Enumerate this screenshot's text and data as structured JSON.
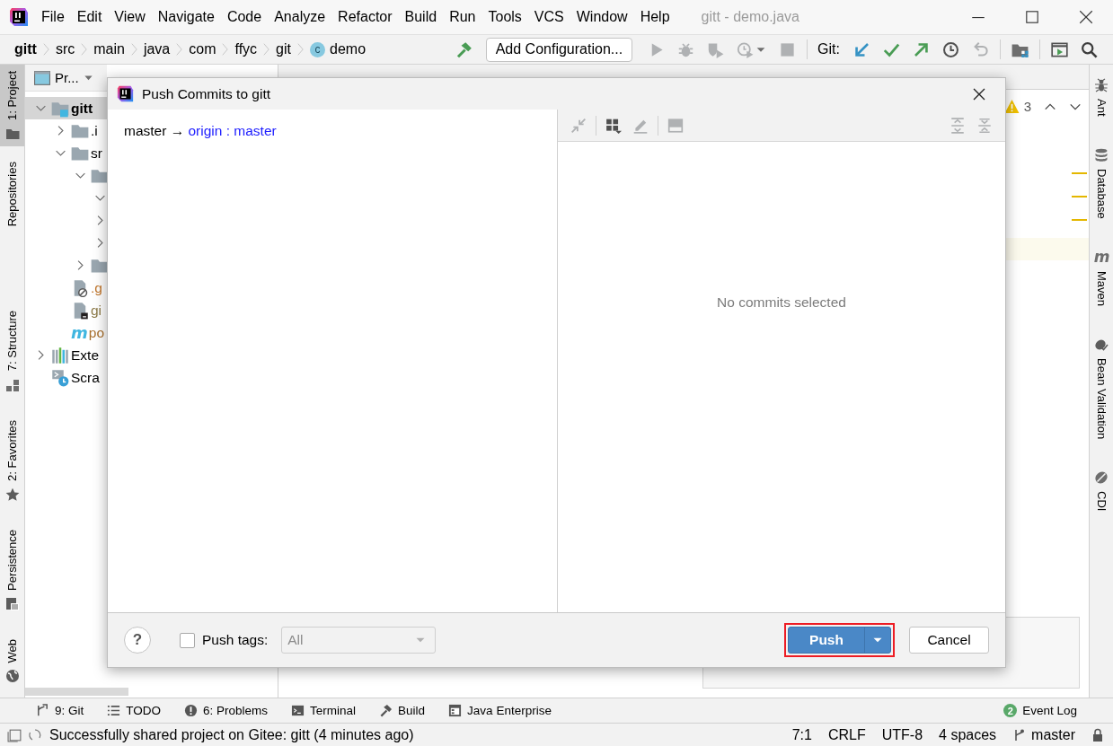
{
  "window": {
    "title": "gitt - demo.java"
  },
  "menu": [
    "File",
    "Edit",
    "View",
    "Navigate",
    "Code",
    "Analyze",
    "Refactor",
    "Build",
    "Run",
    "Tools",
    "VCS",
    "Window",
    "Help"
  ],
  "breadcrumbs": [
    {
      "label": "gitt",
      "kind": "project"
    },
    {
      "label": "src",
      "kind": "folder"
    },
    {
      "label": "main",
      "kind": "folder"
    },
    {
      "label": "java",
      "kind": "folder"
    },
    {
      "label": "com",
      "kind": "folder"
    },
    {
      "label": "ffyc",
      "kind": "folder"
    },
    {
      "label": "git",
      "kind": "folder"
    },
    {
      "label": "demo",
      "kind": "class",
      "icon_letter": "c"
    }
  ],
  "toolbar": {
    "before": [
      {
        "kind": "build",
        "disabled": false
      }
    ],
    "run_config": "Add Configuration...",
    "run": [
      {
        "kind": "run",
        "disabled": true
      },
      {
        "kind": "debug",
        "disabled": true
      },
      {
        "kind": "coverage",
        "disabled": true
      },
      {
        "kind": "profile",
        "disabled": true
      },
      {
        "kind": "stop",
        "disabled": true
      }
    ],
    "git_label": "Git:",
    "git": [
      {
        "kind": "update",
        "disabled": false
      },
      {
        "kind": "commit",
        "disabled": false
      },
      {
        "kind": "push",
        "disabled": false
      },
      {
        "kind": "history",
        "disabled": false
      },
      {
        "kind": "rollback",
        "disabled": true
      }
    ],
    "after": [
      {
        "kind": "project-structure",
        "disabled": false
      },
      {
        "kind": "run-anything",
        "disabled": false
      },
      {
        "kind": "search",
        "disabled": false
      }
    ]
  },
  "left_strip": {
    "top": [
      {
        "label": "1: Project",
        "kind": "project",
        "selected": true
      },
      {
        "label": "Repositories",
        "kind": "none",
        "selected": false
      }
    ],
    "bottom": [
      {
        "label": "7: Structure",
        "kind": "structure",
        "selected": false
      },
      {
        "label": "2: Favorites",
        "kind": "favorites",
        "selected": false
      },
      {
        "label": "Persistence",
        "kind": "persistence",
        "selected": false
      },
      {
        "label": "Web",
        "kind": "web",
        "selected": false
      }
    ]
  },
  "right_strip": [
    {
      "label": "Ant",
      "kind": "ant"
    },
    {
      "label": "Database",
      "kind": "database"
    },
    {
      "label": "Maven",
      "kind": "maven",
      "icon_letter": "m"
    },
    {
      "label": "Bean Validation",
      "kind": "bean"
    },
    {
      "label": "CDI",
      "kind": "cdi"
    }
  ],
  "project": {
    "view": "Pr...",
    "tree": [
      {
        "label": "gitt",
        "kind": "module",
        "expanded": true,
        "selected": true,
        "children": [
          {
            "label": ".i",
            "kind": "folder",
            "expanded": false,
            "selected": false
          },
          {
            "label": "sr",
            "kind": "folder",
            "expanded": true,
            "selected": false,
            "children": [
              {
                "kind": "folder",
                "expanded": true,
                "selected": false,
                "children": [
                  {
                    "expanded": true
                  },
                  {
                    "expanded": false
                  },
                  {
                    "expanded": false
                  }
                ]
              },
              {
                "kind": "folder",
                "expanded": false,
                "selected": false
              }
            ]
          },
          {
            "label": ".g",
            "kind": "ignored-file",
            "selected": false,
            "color": "#c0752a"
          },
          {
            "label": "gi",
            "kind": "file",
            "selected": false,
            "color": "#8c7a48"
          },
          {
            "label": "po",
            "kind": "maven",
            "icon_letter": "m",
            "selected": false,
            "color": "#a86f2c"
          }
        ]
      },
      {
        "label": "Exte",
        "kind": "libraries",
        "expanded": false,
        "selected": false
      },
      {
        "label": "Scra",
        "kind": "scratches",
        "selected": false
      }
    ]
  },
  "editor": {
    "warnings": "3"
  },
  "dialog": {
    "title": "Push Commits to gitt",
    "branch_mapping": {
      "local": "master",
      "arrow": "→",
      "remote": "origin",
      "separator": ":",
      "remote_branch": "master"
    },
    "details_toolbar": [
      {
        "kind": "merge",
        "disabled": true
      },
      {
        "kind": "group",
        "disabled": false
      },
      {
        "kind": "edit",
        "disabled": true
      },
      {
        "kind": "preview",
        "disabled": true
      },
      {
        "kind": "expand-all",
        "disabled": true
      },
      {
        "kind": "collapse-all",
        "disabled": true
      }
    ],
    "empty_text": "No commits selected",
    "help": "?",
    "push_tags": {
      "label": "Push tags:",
      "checked": false,
      "option": "All",
      "disabled": true
    },
    "buttons": [
      {
        "label": "Push",
        "kind": "primary",
        "highlighted": true
      },
      {
        "label": "Cancel",
        "kind": "secondary",
        "highlighted": false
      }
    ]
  },
  "tool_windows": [
    {
      "label": "9: Git",
      "kind": "git"
    },
    {
      "label": "TODO",
      "kind": "todo"
    },
    {
      "label": "6: Problems",
      "kind": "problems"
    },
    {
      "label": "Terminal",
      "kind": "terminal"
    },
    {
      "label": "Build",
      "kind": "build"
    },
    {
      "label": "Java Enterprise",
      "kind": "javaee"
    }
  ],
  "event_log": {
    "label": "Event Log",
    "badge": "2"
  },
  "status_bar": {
    "message": "Successfully shared project on Gitee: gitt (4 minutes ago)",
    "items": [
      "7:1",
      "CRLF",
      "UTF-8",
      "4 spaces"
    ],
    "branch": "master"
  }
}
